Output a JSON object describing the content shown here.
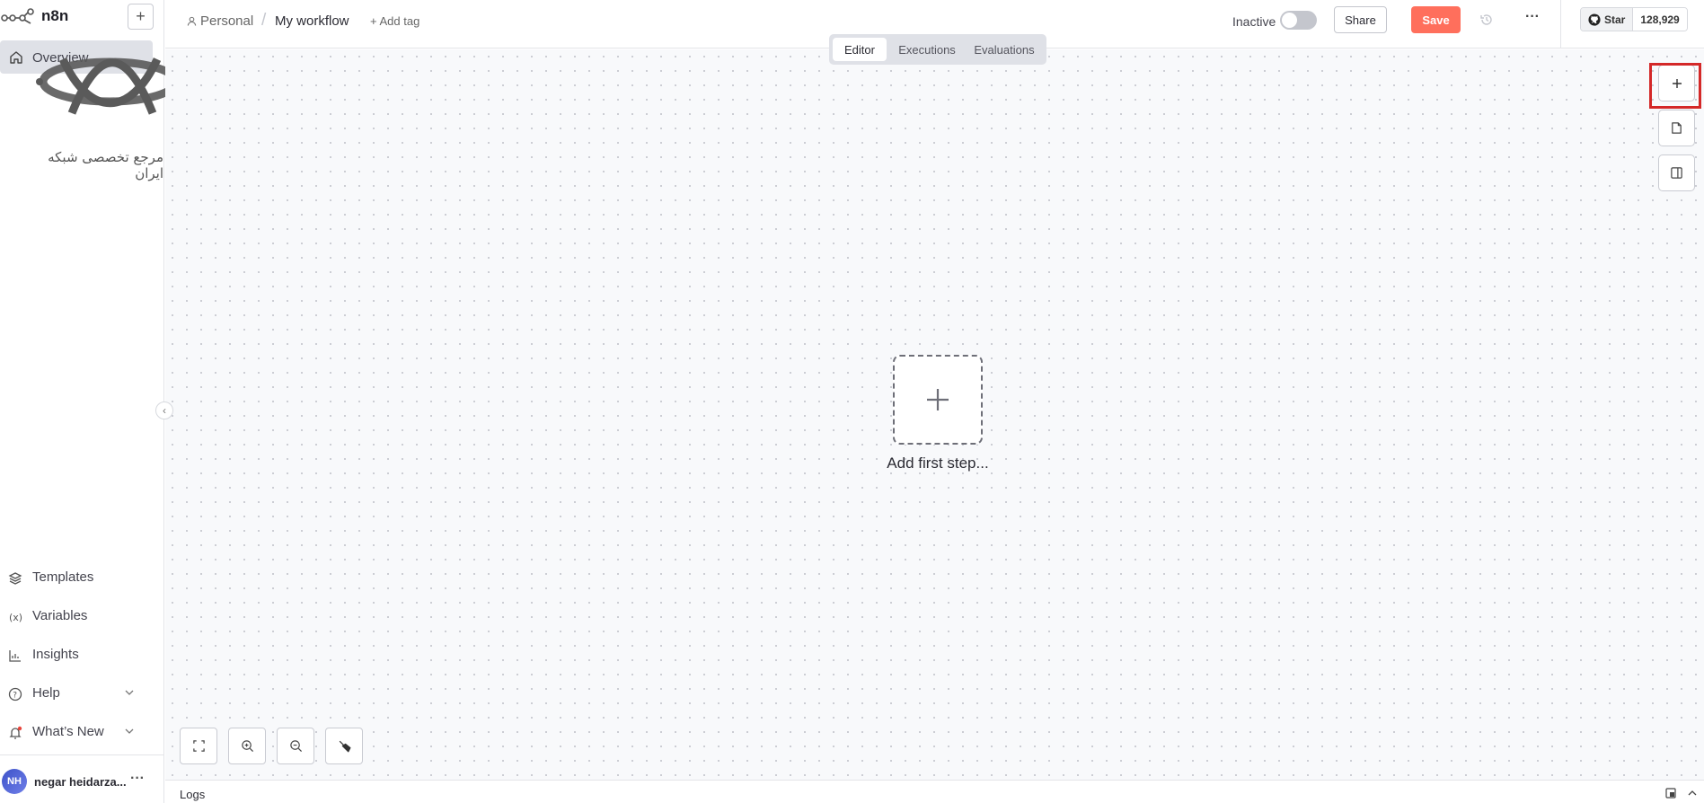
{
  "sidebar": {
    "brand": "n8n",
    "overview_label": "Overview",
    "watermark_text": "مرجع تخصصی شبکه ایران",
    "items": [
      {
        "label": "Templates",
        "icon": "templates-icon"
      },
      {
        "label": "Variables",
        "icon": "variables-icon"
      },
      {
        "label": "Insights",
        "icon": "insights-icon"
      },
      {
        "label": "Help",
        "icon": "help-icon"
      },
      {
        "label": "What’s New",
        "icon": "bell-icon"
      }
    ],
    "user": {
      "initials": "NH",
      "name": "negar heidarza..."
    }
  },
  "header": {
    "project": "Personal",
    "workflow_name": "My workflow",
    "add_tag": "+ Add tag",
    "status_label": "Inactive",
    "share": "Share",
    "save": "Save",
    "github_star": "Star",
    "github_count": "128,929"
  },
  "tabs": [
    "Editor",
    "Executions",
    "Evaluations"
  ],
  "canvas": {
    "add_first_step": "Add first step..."
  },
  "logs": {
    "label": "Logs"
  },
  "colors": {
    "accent": "#ff6f5c",
    "highlight": "#d42828"
  }
}
